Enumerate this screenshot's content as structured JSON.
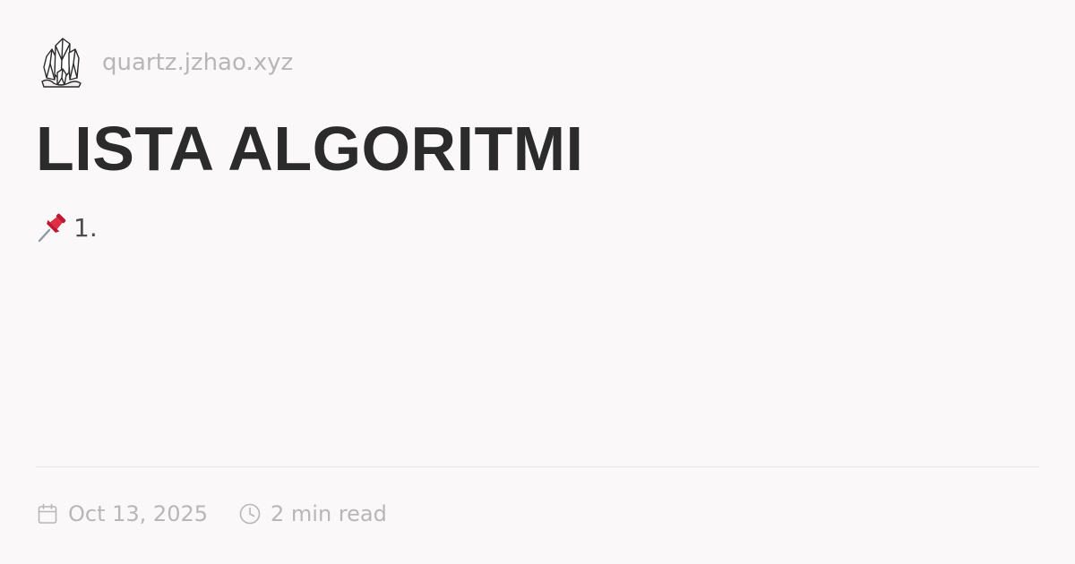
{
  "site": {
    "url": "quartz.jzhao.xyz",
    "logo_icon": "crystal-cluster-icon"
  },
  "page": {
    "title": "LISTA ALGORITMI",
    "excerpt": {
      "icon": "pushpin-icon",
      "text": "1."
    }
  },
  "meta": {
    "date_icon": "calendar-icon",
    "date": "Oct 13, 2025",
    "read_icon": "clock-icon",
    "reading_time": "2 min read"
  },
  "colors": {
    "background": "#faf8f8",
    "title": "#2b2b2b",
    "muted": "#b8b6b6",
    "divider": "#e6e4e4",
    "pin_red": "#e0343f"
  }
}
